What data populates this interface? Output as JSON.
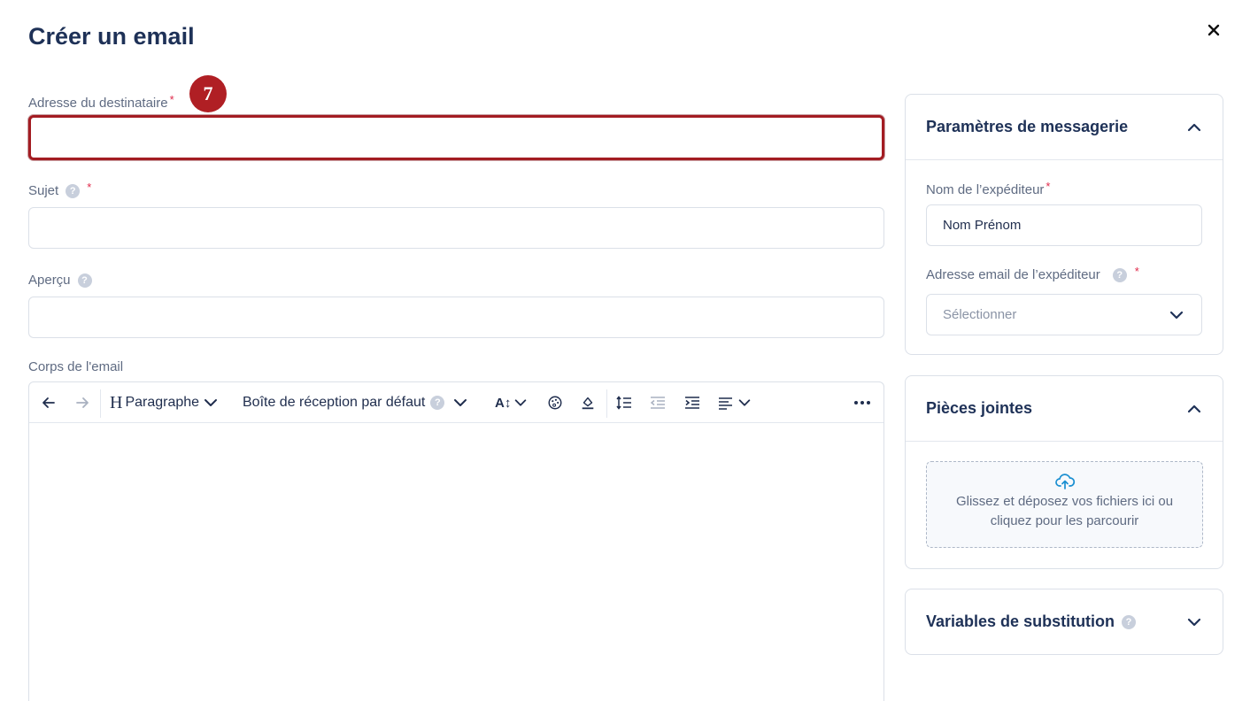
{
  "page": {
    "title": "Créer un email"
  },
  "form": {
    "recipient": {
      "label": "Adresse du destinataire",
      "required_mark": "*",
      "value": ""
    },
    "subject": {
      "label": "Sujet",
      "help": "?",
      "required_mark": "*",
      "value": ""
    },
    "preview": {
      "label": "Aperçu",
      "help": "?",
      "value": ""
    },
    "body": {
      "label": "Corps de l'email"
    }
  },
  "step_badge": "7",
  "toolbar": {
    "heading_glyph": "H",
    "paragraph_label": "Paragraphe",
    "inbox_label": "Boîte de réception par défaut",
    "help": "?",
    "font_size_glyph": "A↕"
  },
  "messaging_settings": {
    "title": "Paramètres de messagerie",
    "sender_name_label": "Nom de l’expéditeur",
    "sender_name_value": "Nom Prénom",
    "sender_email_label": "Adresse email de l’expéditeur",
    "sender_email_placeholder": "Sélectionner",
    "required_mark": "*",
    "help": "?"
  },
  "attachments": {
    "title": "Pièces jointes",
    "dropzone_line1": "Glissez et déposez vos fichiers ici ou",
    "dropzone_line2": "cliquez pour les parcourir"
  },
  "variables": {
    "title": "Variables de substitution",
    "help": "?"
  },
  "colors": {
    "focus_border": "#a31c22",
    "badge": "#b01f24",
    "title": "#1e3157",
    "required": "#e0294a",
    "upload_icon": "#1a8fd1"
  }
}
